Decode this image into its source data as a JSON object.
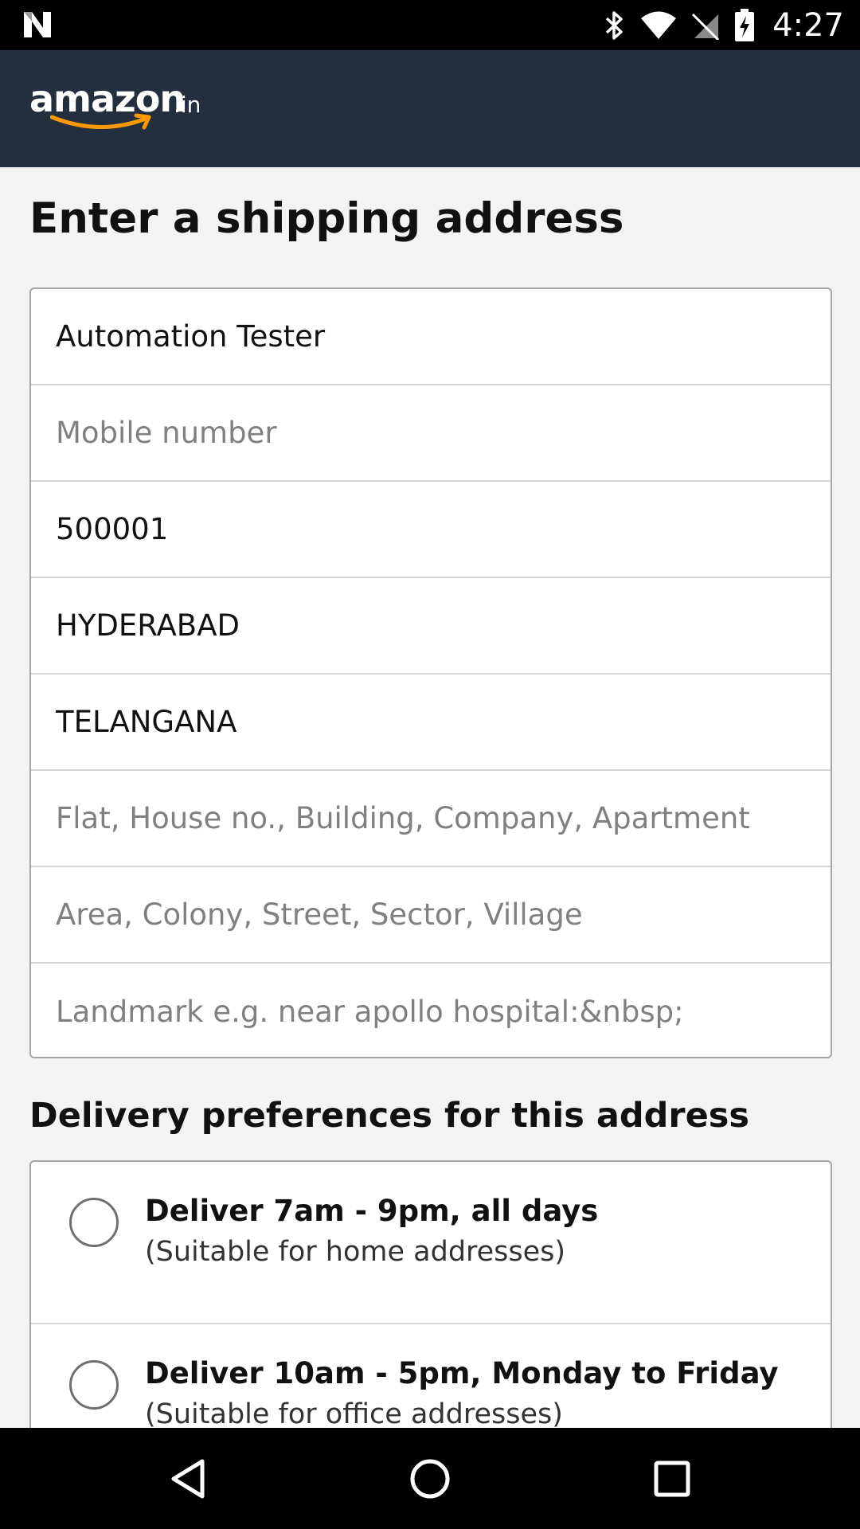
{
  "status_bar": {
    "time": "4:27",
    "icons": [
      "notification-n-icon",
      "bluetooth-icon",
      "wifi-icon",
      "no-sim-icon",
      "battery-charging-icon"
    ]
  },
  "header": {
    "logo_text": "amazon",
    "logo_suffix": ".in"
  },
  "page": {
    "title": "Enter a shipping address"
  },
  "address_form": {
    "fields": [
      {
        "name": "full-name-field",
        "value": "Automation Tester",
        "placeholder": ""
      },
      {
        "name": "mobile-number-field",
        "value": "",
        "placeholder": "Mobile number"
      },
      {
        "name": "pincode-field",
        "value": "500001",
        "placeholder": ""
      },
      {
        "name": "city-field",
        "value": "HYDERABAD",
        "placeholder": ""
      },
      {
        "name": "state-field",
        "value": "TELANGANA",
        "placeholder": ""
      },
      {
        "name": "flat-house-field",
        "value": "",
        "placeholder": "Flat, House no., Building, Company, Apartment"
      },
      {
        "name": "area-street-field",
        "value": "",
        "placeholder": "Area, Colony, Street, Sector, Village"
      },
      {
        "name": "landmark-field",
        "value": "",
        "placeholder": "Landmark e.g. near apollo hospital:&nbsp;"
      }
    ]
  },
  "delivery_preferences": {
    "title": "Delivery preferences for this address",
    "options": [
      {
        "title": "Deliver 7am - 9pm, all days",
        "subtitle": "(Suitable for home addresses)"
      },
      {
        "title": "Deliver 10am - 5pm, Monday to Friday",
        "subtitle": "(Suitable for office addresses)"
      }
    ]
  },
  "nav_bar": {
    "icons": [
      "back-icon",
      "home-icon",
      "recent-apps-icon"
    ]
  },
  "colors": {
    "header_bg": "#232f3e",
    "logo_smile": "#ff9900",
    "page_bg": "#f3f3f3"
  }
}
